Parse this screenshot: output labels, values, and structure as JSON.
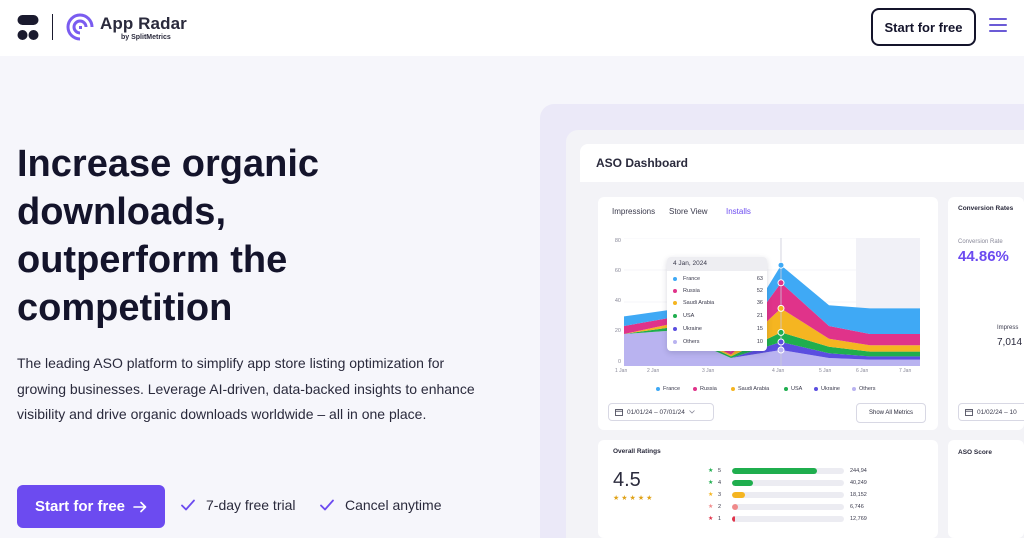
{
  "header": {
    "brand_name": "App Radar",
    "brand_sub": "by SplitMetrics",
    "cta_label": "Start for free"
  },
  "hero": {
    "title_lines": [
      "Increase organic",
      "downloads,",
      "outperform the",
      "competition"
    ],
    "description": "The leading ASO platform to simplify app store listing optimization for growing businesses. Leverage AI-driven, data-backed insights to enhance visibility and drive organic downloads worldwide – all in one place.",
    "cta_label": "Start for free",
    "perks": [
      "7-day free trial",
      "Cancel anytime"
    ]
  },
  "dashboard": {
    "title": "ASO Dashboard",
    "tabs": [
      {
        "label": "Impressions",
        "active": false
      },
      {
        "label": "Store View",
        "active": false
      },
      {
        "label": "Installs",
        "active": true
      }
    ],
    "tooltip": {
      "date": "4 Jan, 2024",
      "rows": [
        {
          "label": "France",
          "value": "63",
          "color": "#3fa9f5"
        },
        {
          "label": "Russia",
          "value": "52",
          "color": "#e0338a"
        },
        {
          "label": "Saudi Arabia",
          "value": "36",
          "color": "#f5b521"
        },
        {
          "label": "USA",
          "value": "21",
          "color": "#1fae4e"
        },
        {
          "label": "Ukraine",
          "value": "15",
          "color": "#5b4ee0"
        },
        {
          "label": "Others",
          "value": "10",
          "color": "#b9b3f0"
        }
      ]
    },
    "date_range": "01/01/24 – 07/01/24",
    "show_metrics_label": "Show All Metrics",
    "conversion": {
      "title": "Conversion Rates",
      "label": "Conversion Rate",
      "value": "44.86%",
      "impressions_label": "Impress",
      "impressions_value": "7,014",
      "date_range": "01/02/24 – 10"
    },
    "ratings": {
      "title": "Overall Ratings",
      "value": "4.5",
      "stars": "★★★★★",
      "rows": [
        {
          "stars": "5",
          "count": "244,94",
          "fraction": 0.76,
          "color": "#1fae4e",
          "star_color": "#1fae4e"
        },
        {
          "stars": "4",
          "count": "40,249",
          "fraction": 0.19,
          "color": "#1fae4e",
          "star_color": "#1fae4e"
        },
        {
          "stars": "3",
          "count": "18,152",
          "fraction": 0.12,
          "color": "#f5b521",
          "star_color": "#f5b521"
        },
        {
          "stars": "2",
          "count": "6,746",
          "fraction": 0.05,
          "color": "#f08a8a",
          "star_color": "#f08a8a"
        },
        {
          "stars": "1",
          "count": "12,769",
          "fraction": 0.03,
          "color": "#e0334a",
          "star_color": "#e0334a"
        }
      ]
    },
    "aso_score_title": "ASO Score"
  },
  "chart_data": {
    "type": "area",
    "stacked": true,
    "categories": [
      "1 Jan",
      "2 Jan",
      "3 Jan",
      "4 Jan",
      "5 Jan",
      "6 Jan",
      "7 Jan"
    ],
    "yticks": [
      "0",
      "20",
      "40",
      "60",
      "80"
    ],
    "ylim": [
      0,
      80
    ],
    "highlight_category": "4 Jan",
    "series": [
      {
        "name": "Others",
        "color": "#b9b3f0",
        "values": [
          20,
          22,
          5,
          10,
          5,
          4,
          4
        ]
      },
      {
        "name": "Ukraine",
        "color": "#5b4ee0",
        "values": [
          0,
          0,
          0,
          5,
          3,
          2,
          2
        ]
      },
      {
        "name": "USA",
        "color": "#1fae4e",
        "values": [
          0,
          2,
          1,
          6,
          4,
          3,
          3
        ]
      },
      {
        "name": "Saudi Arabia",
        "color": "#f5b521",
        "values": [
          0,
          2,
          1,
          15,
          5,
          4,
          4
        ]
      },
      {
        "name": "Russia",
        "color": "#e0338a",
        "values": [
          5,
          4,
          2,
          16,
          8,
          7,
          7
        ]
      },
      {
        "name": "France",
        "color": "#3fa9f5",
        "values": [
          6,
          5,
          3,
          11,
          13,
          16,
          16
        ]
      }
    ]
  }
}
